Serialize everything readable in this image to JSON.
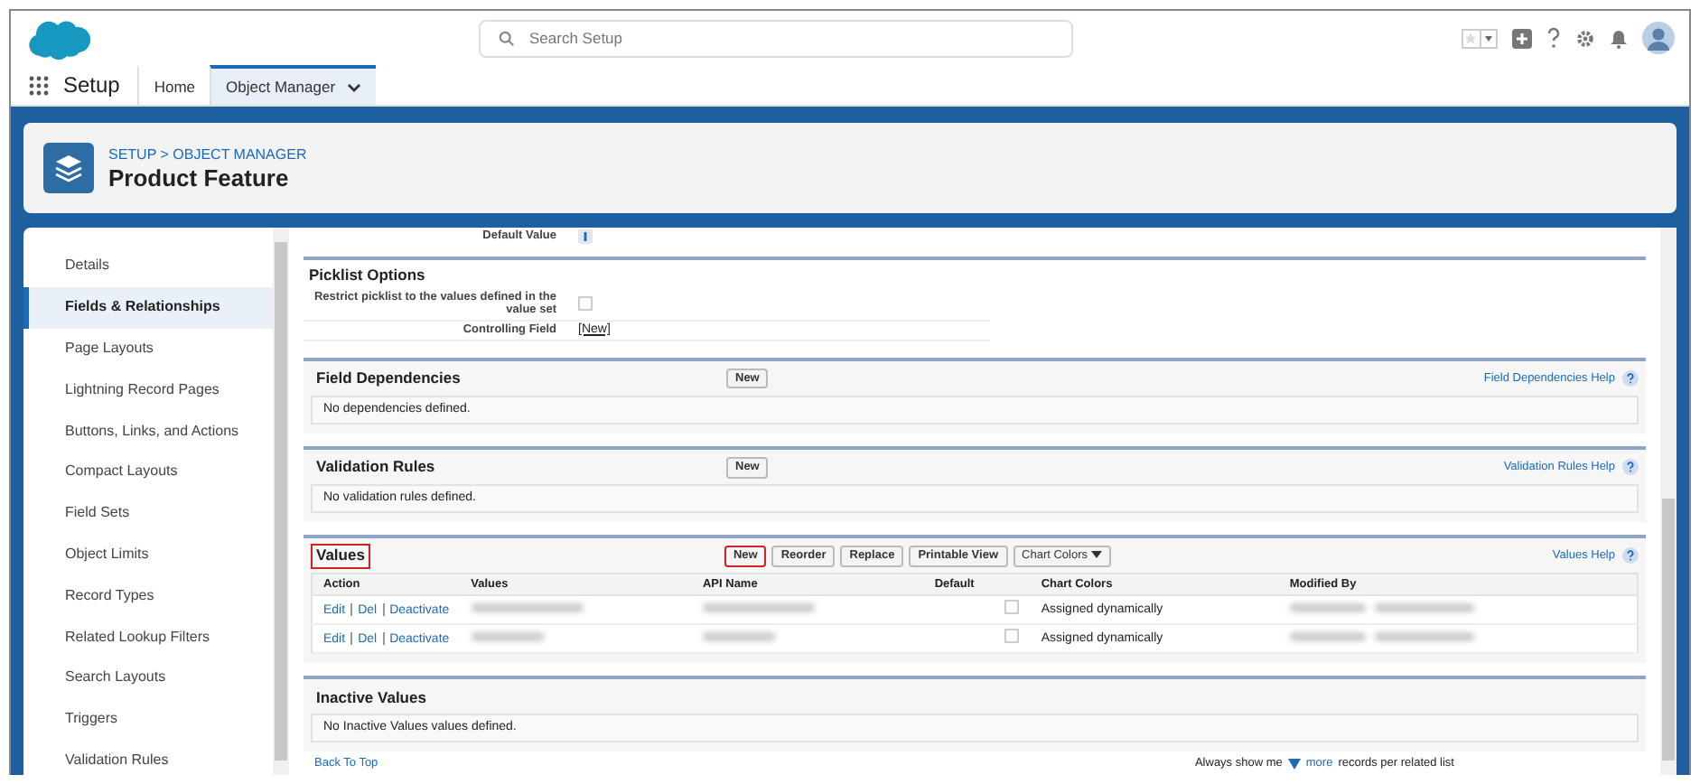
{
  "header": {
    "search": {
      "placeholder": "Search Setup"
    }
  },
  "nav": {
    "app_name": "Setup",
    "tabs": [
      {
        "label": "Home",
        "selected": false,
        "dropdown": false
      },
      {
        "label": "Object Manager",
        "selected": true,
        "dropdown": true
      }
    ]
  },
  "page_header": {
    "breadcrumb": "SETUP > OBJECT MANAGER",
    "title": "Product Feature"
  },
  "sidebar": {
    "items": [
      {
        "label": "Details",
        "selected": false
      },
      {
        "label": "Fields & Relationships",
        "selected": true
      },
      {
        "label": "Page Layouts",
        "selected": false
      },
      {
        "label": "Lightning Record Pages",
        "selected": false
      },
      {
        "label": "Buttons, Links, and Actions",
        "selected": false
      },
      {
        "label": "Compact Layouts",
        "selected": false
      },
      {
        "label": "Field Sets",
        "selected": false
      },
      {
        "label": "Object Limits",
        "selected": false
      },
      {
        "label": "Record Types",
        "selected": false
      },
      {
        "label": "Related Lookup Filters",
        "selected": false
      },
      {
        "label": "Search Layouts",
        "selected": false
      },
      {
        "label": "Triggers",
        "selected": false
      },
      {
        "label": "Validation Rules",
        "selected": false
      }
    ]
  },
  "top_field": {
    "label": "Default Value"
  },
  "picklist_options": {
    "title": "Picklist Options",
    "rows": [
      {
        "kind": "checkbox",
        "label": "Restrict picklist to the values defined in the value set",
        "checked": false
      },
      {
        "kind": "link",
        "label": "Controlling Field",
        "value": "[New]"
      }
    ]
  },
  "sections": [
    {
      "title": "Field Dependencies",
      "highlighted": false,
      "buttons": [
        {
          "label": "New",
          "kind": "plain",
          "highlighted": false
        }
      ],
      "help": "Field Dependencies Help",
      "empty": "No dependencies defined."
    },
    {
      "title": "Validation Rules",
      "highlighted": false,
      "buttons": [
        {
          "label": "New",
          "kind": "plain",
          "highlighted": false
        }
      ],
      "help": "Validation Rules Help",
      "empty": "No validation rules defined."
    },
    {
      "title": "Values",
      "highlighted": true,
      "buttons": [
        {
          "label": "New",
          "kind": "plain",
          "highlighted": true
        },
        {
          "label": "Reorder",
          "kind": "plain",
          "highlighted": false
        },
        {
          "label": "Replace",
          "kind": "plain",
          "highlighted": false
        },
        {
          "label": "Printable View",
          "kind": "plain",
          "highlighted": false
        },
        {
          "label": "Chart Colors",
          "kind": "dropdown",
          "highlighted": false
        }
      ],
      "help": "Values Help",
      "table": {
        "columns": [
          "Action",
          "Values",
          "API Name",
          "Default",
          "Chart Colors",
          "Modified By"
        ],
        "rows": [
          {
            "actions": [
              "Edit",
              "Del",
              "Deactivate"
            ],
            "default": false,
            "chart_colors": "Assigned dynamically"
          },
          {
            "actions": [
              "Edit",
              "Del",
              "Deactivate"
            ],
            "default": false,
            "chart_colors": "Assigned dynamically"
          }
        ]
      }
    },
    {
      "title": "Inactive Values",
      "highlighted": false,
      "empty": "No Inactive Values values defined."
    }
  ],
  "footer": {
    "back_to_top": "Back To Top",
    "show_prefix": "Always show me",
    "more_link": "more",
    "show_suffix": "records per related list"
  }
}
